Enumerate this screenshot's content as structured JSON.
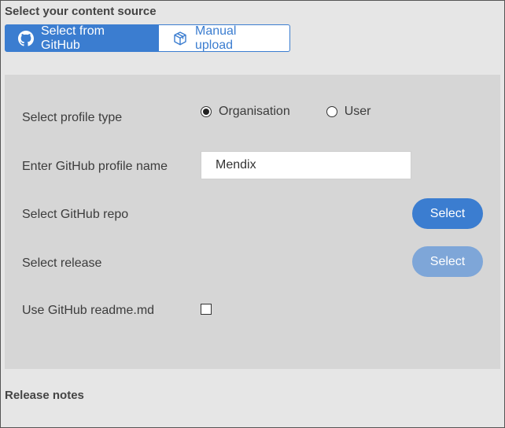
{
  "content_source": {
    "title": "Select your content source",
    "tabs": [
      {
        "label": "Select from GitHub",
        "icon": "github-icon",
        "active": true
      },
      {
        "label": "Manual upload",
        "icon": "package-box-icon",
        "active": false
      }
    ]
  },
  "form": {
    "profile_type": {
      "label": "Select profile type",
      "options": [
        {
          "label": "Organisation",
          "selected": true
        },
        {
          "label": "User",
          "selected": false
        }
      ]
    },
    "profile_name": {
      "label": "Enter GitHub profile name",
      "value": "Mendix"
    },
    "repo": {
      "label": "Select GitHub repo",
      "button_label": "Select"
    },
    "release": {
      "label": "Select release",
      "button_label": "Select",
      "button_disabled": true
    },
    "readme": {
      "label": "Use GitHub readme.md",
      "checked": false
    }
  },
  "release_notes": {
    "title": "Release notes"
  },
  "colors": {
    "accent": "#3b7dd0",
    "accent_disabled": "#7ea6d8",
    "panel_background": "#d6d6d6",
    "page_background": "#e6e6e6"
  }
}
